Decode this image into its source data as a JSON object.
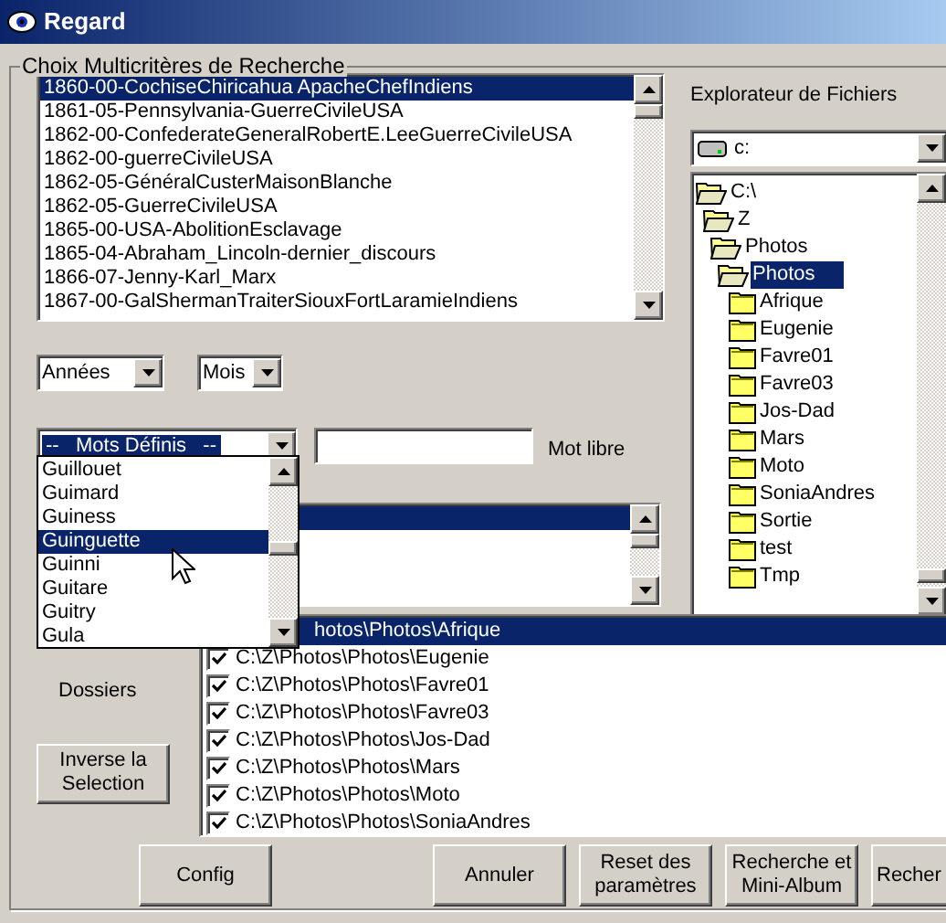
{
  "window": {
    "title": "Regard"
  },
  "search": {
    "title": "Choix  Multicritères de Recherche",
    "events": [
      {
        "label": "1860-00-CochiseChiricahua ApacheChefIndiens",
        "selected": true
      },
      {
        "label": "1861-05-Pennsylvania-GuerreCivileUSA",
        "selected": false
      },
      {
        "label": "1862-00-ConfederateGeneralRobertE.LeeGuerreCivileUSA",
        "selected": false
      },
      {
        "label": "1862-00-guerreCivileUSA",
        "selected": false
      },
      {
        "label": "1862-05-GénéralCusterMaisonBlanche",
        "selected": false
      },
      {
        "label": "1862-05-GuerreCivileUSA",
        "selected": false
      },
      {
        "label": "1865-00-USA-AbolitionEsclavage",
        "selected": false
      },
      {
        "label": "1865-04-Abraham_Lincoln-dernier_discours",
        "selected": false
      },
      {
        "label": "1866-07-Jenny-Karl_Marx",
        "selected": false
      },
      {
        "label": "1867-00-GalShermanTraiterSiouxFortLaramieIndiens",
        "selected": false
      }
    ],
    "year_select": {
      "value": "Années"
    },
    "month_select": {
      "value": "Mois"
    },
    "keyword_combo": {
      "value": "--   Mots Définis   --",
      "expanded": true,
      "options": [
        {
          "label": "Guillouet",
          "selected": false
        },
        {
          "label": "Guimard",
          "selected": false
        },
        {
          "label": "Guiness",
          "selected": false
        },
        {
          "label": "Guinguette",
          "selected": true
        },
        {
          "label": "Guinni",
          "selected": false
        },
        {
          "label": "Guitare",
          "selected": false
        },
        {
          "label": "Guitry",
          "selected": false
        },
        {
          "label": "Gula",
          "selected": false
        }
      ]
    },
    "free_word": {
      "label": "Mot libre"
    },
    "keyword_list": {
      "rows": [
        {
          "selected": true
        },
        {
          "selected": false
        },
        {
          "selected": false
        }
      ]
    }
  },
  "explorer": {
    "title": "Explorateur de Fichiers",
    "drive": "c:",
    "tree": [
      {
        "label": "C:\\",
        "selected": false,
        "expanded": true,
        "children": [
          {
            "label": "Z",
            "selected": false,
            "expanded": true,
            "children": [
              {
                "label": "Photos",
                "selected": false,
                "expanded": true,
                "children": [
                  {
                    "label": "Photos",
                    "selected": true,
                    "expanded": true,
                    "children": [
                      {
                        "label": "Afrique",
                        "selected": false,
                        "expanded": false
                      },
                      {
                        "label": "Eugenie",
                        "selected": false,
                        "expanded": false
                      },
                      {
                        "label": "Favre01",
                        "selected": false,
                        "expanded": false
                      },
                      {
                        "label": "Favre03",
                        "selected": false,
                        "expanded": false
                      },
                      {
                        "label": "Jos-Dad",
                        "selected": false,
                        "expanded": false
                      },
                      {
                        "label": "Mars",
                        "selected": false,
                        "expanded": false
                      },
                      {
                        "label": "Moto",
                        "selected": false,
                        "expanded": false
                      },
                      {
                        "label": "SoniaAndres",
                        "selected": false,
                        "expanded": false
                      },
                      {
                        "label": "Sortie",
                        "selected": false,
                        "expanded": false
                      },
                      {
                        "label": "test",
                        "selected": false,
                        "expanded": false
                      },
                      {
                        "label": "Tmp",
                        "selected": false,
                        "expanded": false
                      }
                    ]
                  }
                ]
              }
            ]
          }
        ]
      }
    ]
  },
  "folders": {
    "label": "Dossiers",
    "invert_button": [
      "Inverse la",
      "Selection"
    ],
    "rows": [
      {
        "path": "hotos\\Photos\\Afrique",
        "selected": true
      },
      {
        "path": "C:\\Z\\Photos\\Photos\\Eugenie",
        "selected": false,
        "checked": true
      },
      {
        "path": "C:\\Z\\Photos\\Photos\\Favre01",
        "selected": false,
        "checked": true
      },
      {
        "path": "C:\\Z\\Photos\\Photos\\Favre03",
        "selected": false,
        "checked": true
      },
      {
        "path": "C:\\Z\\Photos\\Photos\\Jos-Dad",
        "selected": false,
        "checked": true
      },
      {
        "path": "C:\\Z\\Photos\\Photos\\Mars",
        "selected": false,
        "checked": true
      },
      {
        "path": "C:\\Z\\Photos\\Photos\\Moto",
        "selected": false,
        "checked": true
      },
      {
        "path": "C:\\Z\\Photos\\Photos\\SoniaAndres",
        "selected": false,
        "checked": true
      }
    ]
  },
  "buttons": [
    {
      "lines": [
        "Config"
      ]
    },
    {
      "lines": [
        "Annuler"
      ]
    },
    {
      "lines": [
        "Reset des",
        "paramètres"
      ]
    },
    {
      "lines": [
        "Recherche et",
        "Mini-Album"
      ]
    },
    {
      "lines": [
        "Recher"
      ]
    }
  ]
}
